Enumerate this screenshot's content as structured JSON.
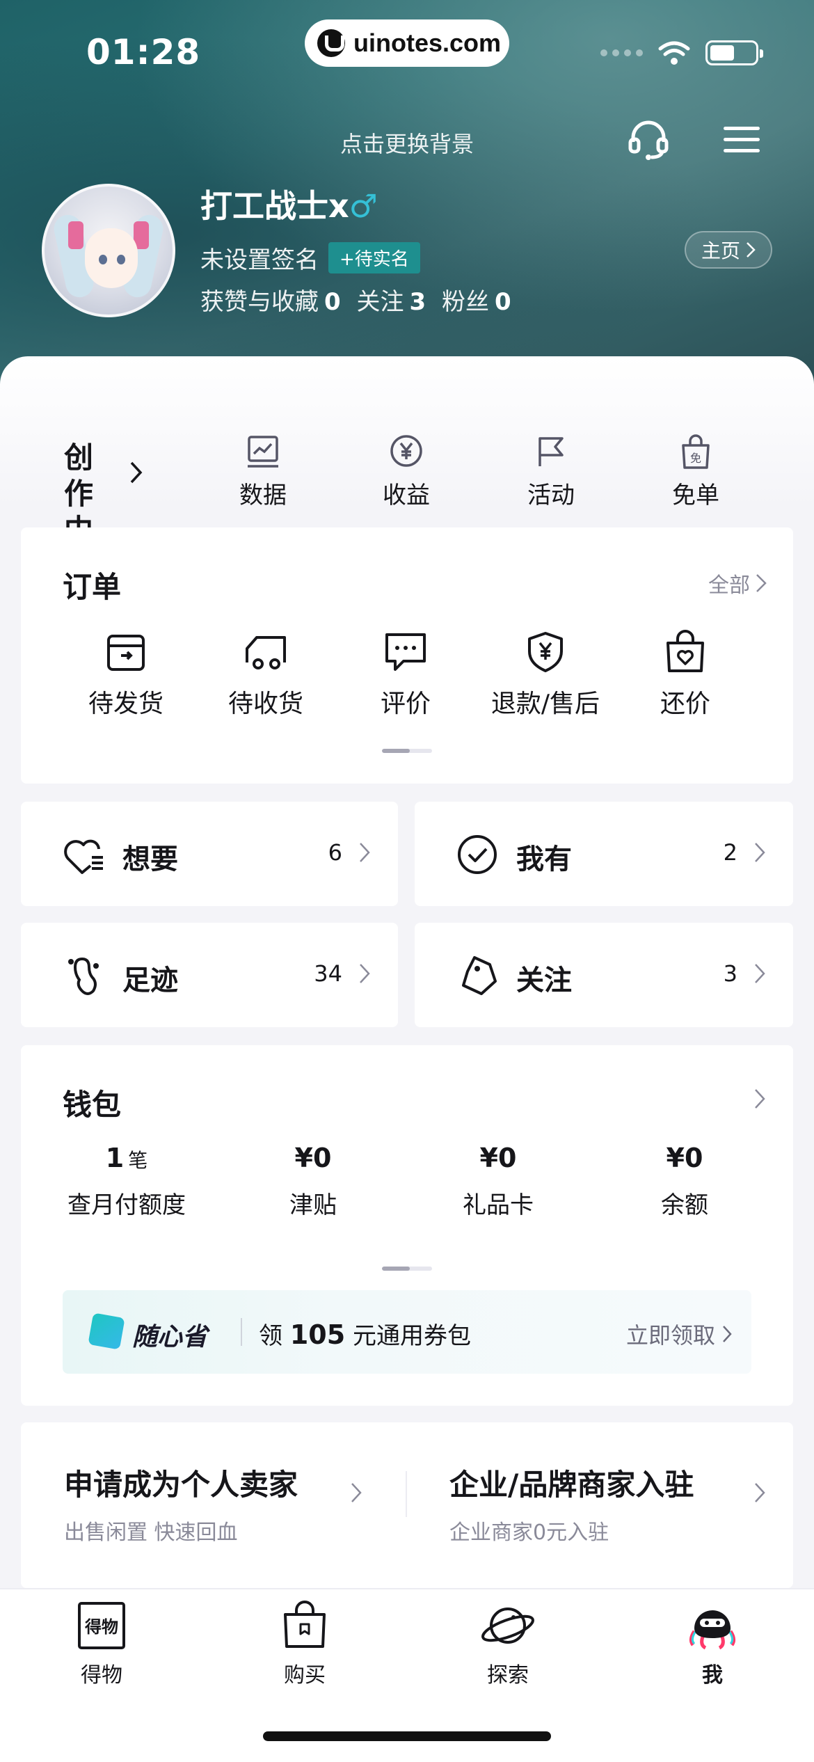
{
  "status_bar": {
    "time": "01:28",
    "url_pill": "uinotes.com"
  },
  "header": {
    "change_background": "点击更换背景",
    "username": "打工战士x",
    "gender_symbol": "♂",
    "signature": "未设置签名",
    "verify_tag": "+待实名",
    "stats": {
      "likes_label": "获赞与收藏",
      "likes_value": "0",
      "following_label": "关注",
      "following_value": "3",
      "fans_label": "粉丝",
      "fans_value": "0"
    },
    "home_button": "主页"
  },
  "creator": {
    "title": "创作中心",
    "items": [
      {
        "label": "数据",
        "icon": "chart-board-icon"
      },
      {
        "label": "收益",
        "icon": "yen-circle-icon"
      },
      {
        "label": "活动",
        "icon": "flag-icon"
      },
      {
        "label": "免单",
        "icon": "free-bag-icon"
      }
    ]
  },
  "orders": {
    "title": "订单",
    "more": "全部",
    "items": [
      {
        "label": "待发货",
        "icon": "box-icon"
      },
      {
        "label": "待收货",
        "icon": "truck-icon"
      },
      {
        "label": "评价",
        "icon": "comment-icon"
      },
      {
        "label": "退款/售后",
        "icon": "shield-yen-icon"
      },
      {
        "label": "还价",
        "icon": "heart-bag-icon"
      }
    ]
  },
  "quick": {
    "want": {
      "label": "想要",
      "count": "6"
    },
    "have": {
      "label": "我有",
      "count": "2"
    },
    "footprint": {
      "label": "足迹",
      "count": "34"
    },
    "follow": {
      "label": "关注",
      "count": "3"
    }
  },
  "wallet": {
    "title": "钱包",
    "items": [
      {
        "value": "1",
        "unit": "笔",
        "label": "查月付额度"
      },
      {
        "value": "¥0",
        "label": "津贴"
      },
      {
        "value": "¥0",
        "label": "礼品卡"
      },
      {
        "value": "¥0",
        "label": "余额"
      }
    ],
    "promo": {
      "brand": "随心省",
      "prefix": "领",
      "amount": "105",
      "suffix": "元通用券包",
      "action": "立即领取"
    }
  },
  "seller": {
    "personal": {
      "title": "申请成为个人卖家",
      "subtitle": "出售闲置 快速回血"
    },
    "business": {
      "title": "企业/品牌商家入驻",
      "subtitle": "企业商家0元入驻"
    }
  },
  "tabbar": {
    "items": [
      {
        "label": "得物",
        "icon": "dewu-logo-icon"
      },
      {
        "label": "购买",
        "icon": "shopping-bag-icon"
      },
      {
        "label": "探索",
        "icon": "planet-icon"
      },
      {
        "label": "我",
        "icon": "octopus-avatar-icon"
      }
    ],
    "logo_text": "得物"
  },
  "colors": {
    "header_teal": "#2a6f74",
    "accent_teal": "#1e8f8f",
    "text_primary": "#16161a",
    "text_secondary": "#8a8a99",
    "page_bg": "#f4f4f8"
  }
}
